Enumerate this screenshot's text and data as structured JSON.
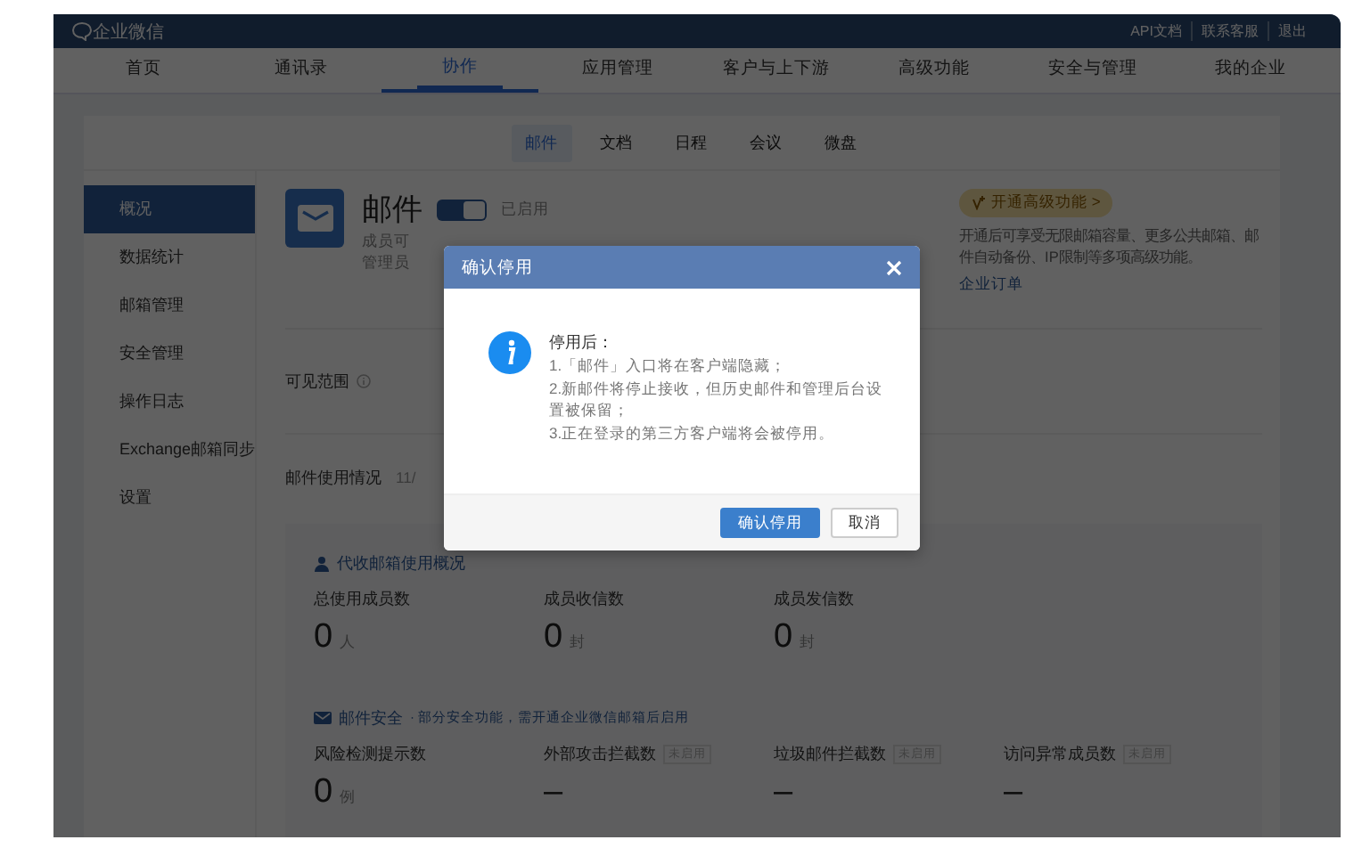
{
  "app": {
    "name": "企业微信"
  },
  "top_links": [
    "API文档",
    "联系客服",
    "退出"
  ],
  "nav": [
    {
      "label": "首页",
      "selected": false
    },
    {
      "label": "通讯录",
      "selected": false
    },
    {
      "label": "协作",
      "selected": true
    },
    {
      "label": "应用管理",
      "selected": false
    },
    {
      "label": "客户与上下游",
      "selected": false
    },
    {
      "label": "高级功能",
      "selected": false
    },
    {
      "label": "安全与管理",
      "selected": false
    },
    {
      "label": "我的企业",
      "selected": false
    }
  ],
  "sub_tabs": [
    {
      "label": "邮件",
      "selected": true
    },
    {
      "label": "文档",
      "selected": false
    },
    {
      "label": "日程",
      "selected": false
    },
    {
      "label": "会议",
      "selected": false
    },
    {
      "label": "微盘",
      "selected": false
    }
  ],
  "sidebar": [
    {
      "label": "概况",
      "selected": true
    },
    {
      "label": "数据统计",
      "selected": false
    },
    {
      "label": "邮箱管理",
      "selected": false
    },
    {
      "label": "安全管理",
      "selected": false
    },
    {
      "label": "操作日志",
      "selected": false
    },
    {
      "label": "Exchange邮箱同步",
      "selected": false
    },
    {
      "label": "设置",
      "selected": false
    }
  ],
  "app_header": {
    "title": "邮件",
    "enabled": true,
    "status": "已启用",
    "description": [
      "成员可",
      "管理员"
    ]
  },
  "upgrade": {
    "badge": "开通高级功能 >",
    "text": "开通后可享受无限邮箱容量、更多公共邮箱、邮件自动备份、IP限制等多项高级功能。",
    "link": "企业订单"
  },
  "visibility": {
    "label": "可见范围"
  },
  "usage": {
    "label": "邮件使用情况",
    "date": "11/"
  },
  "proxy_section": {
    "title": "代收邮箱使用概况",
    "stats": [
      {
        "label": "总使用成员数",
        "value": "0",
        "unit": "人"
      },
      {
        "label": "成员收信数",
        "value": "0",
        "unit": "封"
      },
      {
        "label": "成员发信数",
        "value": "0",
        "unit": "封"
      }
    ]
  },
  "security_section": {
    "title": "邮件安全",
    "note": "· 部分安全功能，需开通企业微信邮箱后启用",
    "stats": [
      {
        "label": "风险检测提示数",
        "value": "0",
        "unit": "例"
      },
      {
        "label": "外部攻击拦截数",
        "badge": "未启用",
        "value": "–"
      },
      {
        "label": "垃圾邮件拦截数",
        "badge": "未启用",
        "value": "–"
      },
      {
        "label": "访问异常成员数",
        "badge": "未启用",
        "value": "–"
      }
    ]
  },
  "dialog": {
    "title": "确认停用",
    "heading": "停用后：",
    "lines": [
      "1.「邮件」入口将在客户端隐藏；",
      "2.新邮件将停止接收，但历史邮件和管理后台设置被保留；",
      "3.正在登录的第三方客户端将会被停用。"
    ],
    "buttons": [
      {
        "label": "确认停用",
        "kind": "primary"
      },
      {
        "label": "取消",
        "kind": "default"
      }
    ]
  }
}
